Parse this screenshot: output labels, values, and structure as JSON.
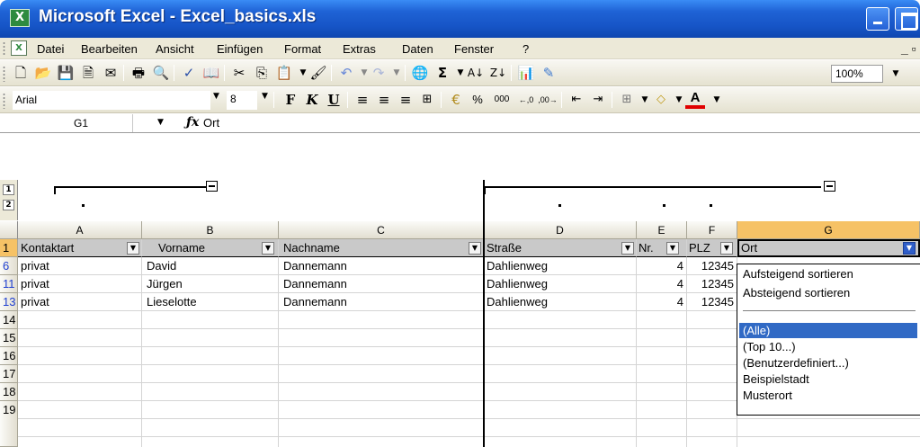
{
  "window": {
    "title": "Microsoft Excel - Excel_basics.xls"
  },
  "menu": [
    "Datei",
    "Bearbeiten",
    "Ansicht",
    "Einfügen",
    "Format",
    "Extras",
    "Daten",
    "Fenster",
    "?"
  ],
  "toolbar": {
    "zoom": "100%"
  },
  "format_toolbar": {
    "font": "Arial",
    "size": "8",
    "percent": "%",
    "thousands": "000"
  },
  "formula_bar": {
    "cell_ref": "G1",
    "fx": "fx",
    "value": "Ort"
  },
  "outline": {
    "levels": [
      "1",
      "2"
    ]
  },
  "columns": [
    "A",
    "B",
    "C",
    "D",
    "E",
    "F",
    "G"
  ],
  "rows": [
    {
      "num": "1",
      "cells": [
        "Kontaktart",
        "Vorname",
        "Nachname",
        "Straße",
        "Nr.",
        "PLZ",
        "Ort"
      ]
    },
    {
      "num": "6",
      "cells": [
        "privat",
        "David",
        "Dannemann",
        "Dahlienweg",
        "4",
        "12345",
        ""
      ]
    },
    {
      "num": "11",
      "cells": [
        "privat",
        "Jürgen",
        "Dannemann",
        "Dahlienweg",
        "4",
        "12345",
        ""
      ]
    },
    {
      "num": "13",
      "cells": [
        "privat",
        "Lieselotte",
        "Dannemann",
        "Dahlienweg",
        "4",
        "12345",
        ""
      ]
    },
    {
      "num": "14",
      "cells": []
    },
    {
      "num": "15",
      "cells": []
    },
    {
      "num": "16",
      "cells": []
    },
    {
      "num": "17",
      "cells": []
    },
    {
      "num": "18",
      "cells": []
    },
    {
      "num": "19",
      "cells": []
    }
  ],
  "autofilter_list": {
    "sort_items": [
      "Aufsteigend sortieren",
      "Absteigend sortieren"
    ],
    "filter_items": [
      "(Alle)",
      "(Top 10...)",
      "(Benutzerdefiniert...)",
      "Beispielstadt",
      "Musterort"
    ],
    "selected": "(Alle)"
  },
  "colors": {
    "titlebar": "#1654c6",
    "selection": "#316ac5",
    "selected_header": "#f6c266",
    "filtered_row": "#1f3fd0"
  }
}
